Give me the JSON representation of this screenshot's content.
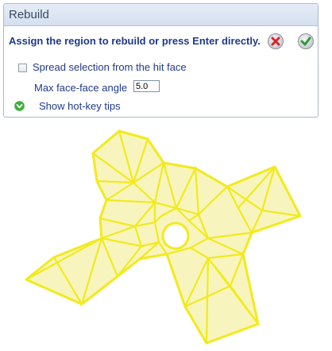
{
  "panel": {
    "title": "Rebuild",
    "instruction": "Assign the region to rebuild or press Enter directly.",
    "spread_label": "Spread selection from the hit face",
    "spread_checked": false,
    "angle_label": "Max face-face angle",
    "angle_value": "5.0",
    "hotkey_label": "Show hot-key tips"
  },
  "icons": {
    "cancel": "cancel-x-icon",
    "ok": "ok-check-icon",
    "expand": "expand-chevron-icon"
  },
  "colors": {
    "mesh_stroke": "#f2ea1c",
    "mesh_fill": "#f7f5bd",
    "cancel_red": "#d8262c",
    "ok_green": "#2e9a3a",
    "text_blue": "#1f3a8a"
  }
}
